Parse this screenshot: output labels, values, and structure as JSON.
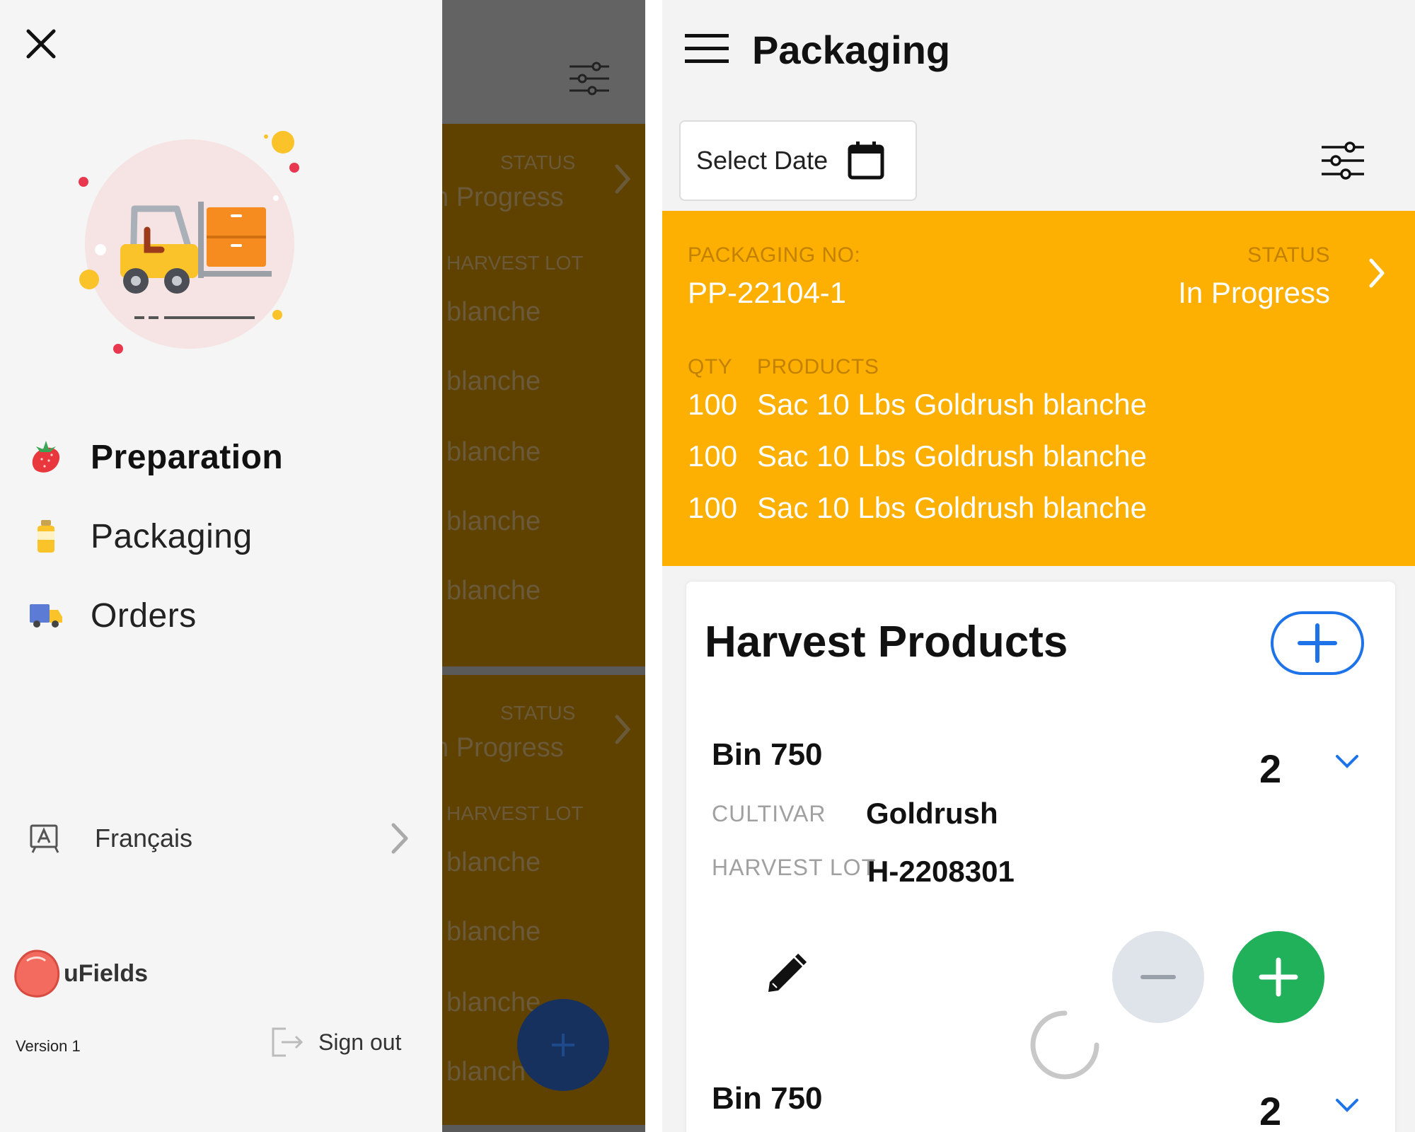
{
  "drawer": {
    "menu": [
      {
        "label": "Preparation",
        "icon": "strawberry-icon"
      },
      {
        "label": "Packaging",
        "icon": "bottle-icon"
      },
      {
        "label": "Orders",
        "icon": "delivery-truck-icon"
      }
    ],
    "language": {
      "label": "Français",
      "icon": "translate-icon"
    },
    "brand": {
      "name": "uFields"
    },
    "version": "Version 1",
    "sign_out": "Sign out"
  },
  "background_list": {
    "status_label": "STATUS",
    "status_value": "n Progress",
    "lot_label": "HARVEST LOT",
    "lines": [
      "blanche",
      "blanche",
      "blanche",
      "blanche",
      "blanche",
      "blanche",
      "blanche",
      "blanche",
      "blanch"
    ]
  },
  "header": {
    "title": "Packaging"
  },
  "filters": {
    "date_label": "Select Date"
  },
  "packaging_card": {
    "no_label": "PACKAGING NO:",
    "no_value": "PP-22104-1",
    "status_label": "STATUS",
    "status_value": "In Progress",
    "qty_label": "QTY",
    "products_label": "PRODUCTS",
    "rows": [
      {
        "qty": "100",
        "product": "Sac 10 Lbs Goldrush blanche"
      },
      {
        "qty": "100",
        "product": "Sac 10 Lbs Goldrush blanche"
      },
      {
        "qty": "100",
        "product": "Sac 10 Lbs Goldrush blanche"
      }
    ]
  },
  "harvest_products": {
    "title": "Harvest Products",
    "bins": [
      {
        "title": "Bin 750",
        "count": "2",
        "cultivar_label": "CULTIVAR",
        "cultivar": "Goldrush",
        "lot_label": "HARVEST LOT",
        "lot": "H-2208301"
      },
      {
        "title": "Bin 750",
        "count": "2"
      }
    ]
  },
  "colors": {
    "accent_yellow": "#fdb001",
    "primary_blue": "#1e73e8",
    "add_green": "#21b15a",
    "fab_navy": "#16315e",
    "overlay_brown": "#5f4100"
  }
}
